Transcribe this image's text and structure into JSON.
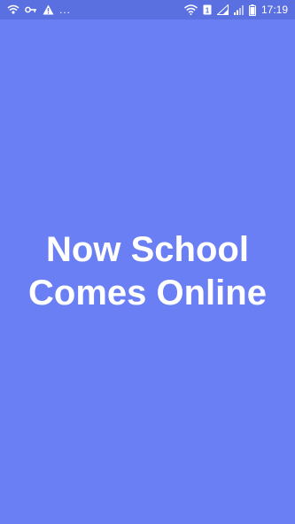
{
  "status_bar": {
    "left_icons": [
      "wifi-calling-icon",
      "key-icon",
      "warning-icon"
    ],
    "overflow": "...",
    "right_icons": [
      "wifi-icon",
      "sim-1-icon",
      "signal-icon",
      "signal-icon-2",
      "battery-icon"
    ],
    "time": "17:19"
  },
  "splash": {
    "title_line_1": "Now School",
    "title_line_2": "Comes Online"
  },
  "colors": {
    "background": "#6a7ff4",
    "status_bar": "#5a6fe0",
    "text": "#ffffff"
  }
}
